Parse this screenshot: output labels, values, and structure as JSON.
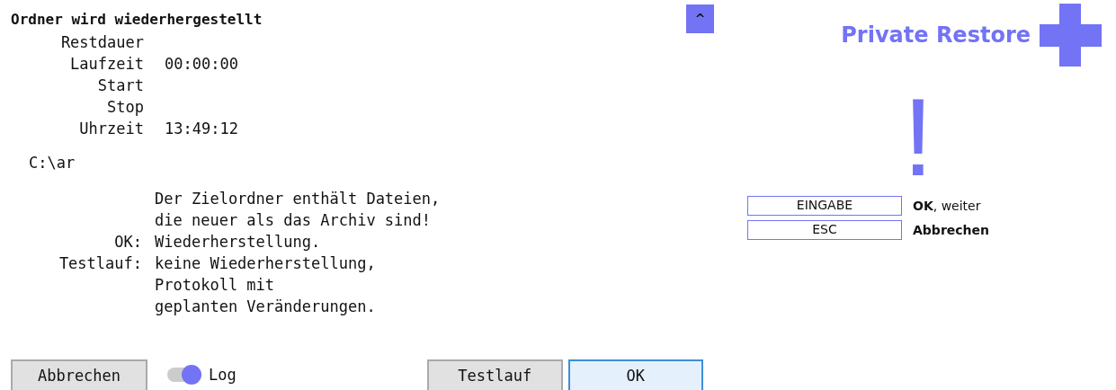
{
  "title": "Ordner wird wiederhergestellt",
  "collapse_button": {
    "label": "^"
  },
  "stats": [
    {
      "label": "Restdauer"
    },
    {
      "label": "Laufzeit",
      "value": "00:00:00"
    },
    {
      "label": "Start"
    },
    {
      "label": "Stop"
    },
    {
      "label": "Uhrzeit",
      "value": "13:49:12"
    }
  ],
  "path": "C:\\ar",
  "message": [
    {
      "text": "Der Zielordner enthält Dateien,"
    },
    {
      "text": "die neuer als das Archiv sind!"
    },
    {
      "label": "OK:",
      "text": "Wiederherstellung."
    },
    {
      "label": "Testlauf:",
      "text": "keine Wiederherstellung,"
    },
    {
      "text": "Protokoll mit"
    },
    {
      "text": "geplanten Veränderungen."
    }
  ],
  "brand": {
    "name": "Private Restore"
  },
  "alert": {
    "symbol": "!"
  },
  "shortcuts": [
    {
      "key": "EINGABE",
      "description": "**OK**, weiter",
      "bold": false
    },
    {
      "key": "ESC",
      "description": "Abbrechen",
      "bold": true
    }
  ],
  "buttons": [
    {
      "label": "Abbrechen",
      "default": false
    },
    {
      "kind": "toggle",
      "label": "Log",
      "on": true
    },
    {
      "label": "Testlauf",
      "default": false
    },
    {
      "label": "OK",
      "default": true
    }
  ]
}
